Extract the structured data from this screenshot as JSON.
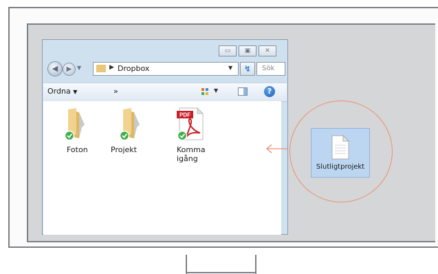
{
  "window": {
    "address_path": "Dropbox",
    "search_placeholder": "Sök",
    "toolbar": {
      "organize_label": "Ordna",
      "more_label": "»"
    },
    "items": [
      {
        "label": "Foton",
        "type": "folder",
        "synced": true
      },
      {
        "label": "Projekt",
        "type": "folder",
        "synced": true
      },
      {
        "label": "Komma igång",
        "type": "pdf",
        "synced": true,
        "badge": "PDF"
      }
    ]
  },
  "dragged_file": {
    "label": "Slutligtprojekt"
  },
  "colors": {
    "highlight_circle": "#ec8f72",
    "sync_badge": "#3fae49",
    "folder": "#e9c77a",
    "pdf_red": "#c8202a"
  }
}
